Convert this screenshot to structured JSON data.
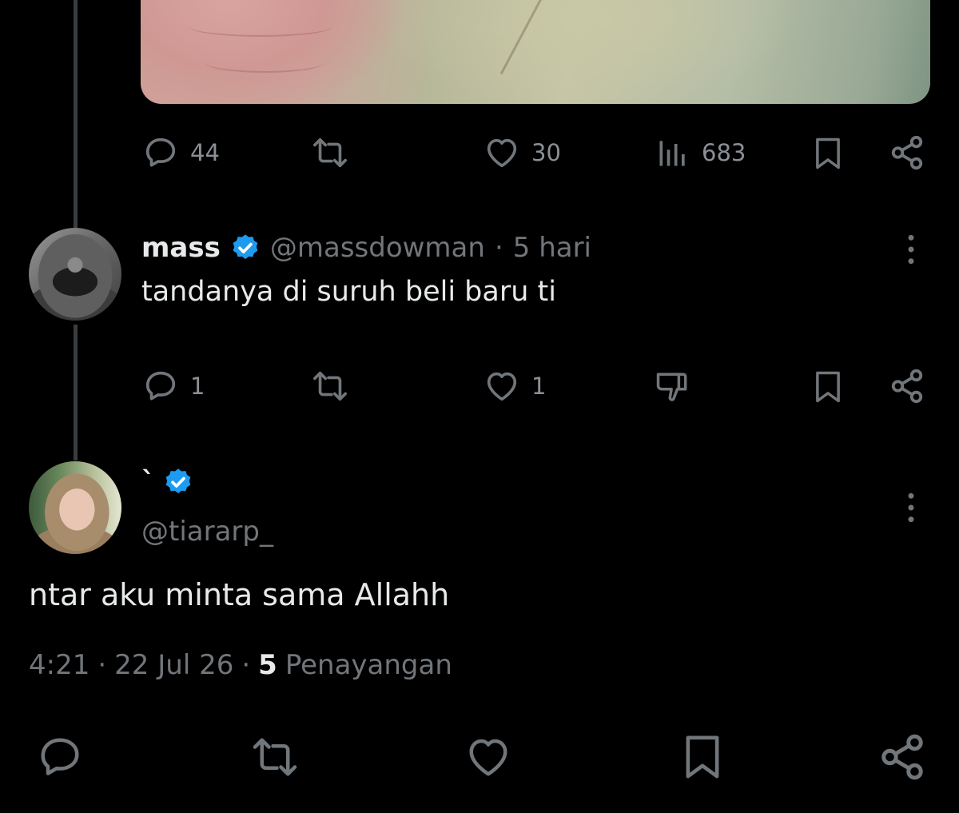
{
  "post": {
    "actions": {
      "replies": "44",
      "likes": "30",
      "views": "683"
    }
  },
  "reply_mass": {
    "display_name": "mass",
    "handle": "@massdowman",
    "separator": "·",
    "time": "5 hari",
    "text": "tandanya di suruh beli baru ti",
    "actions": {
      "replies": "1",
      "likes": "1"
    }
  },
  "reply_tiara": {
    "display_name": "`",
    "handle": "@tiararp_",
    "text": "ntar aku minta sama Allahh",
    "time": "4:21",
    "sep1": "·",
    "date": "22 Jul 26",
    "sep2": "·",
    "views_count": "5",
    "views_label": "Penayangan"
  },
  "colors": {
    "background": "#000000",
    "text_primary": "#e7e9ea",
    "text_secondary": "#71767b",
    "verified_blue": "#1d9bf0",
    "thread_line": "#3a3d40"
  },
  "icons": {
    "reply": "reply-icon",
    "repost": "repost-icon",
    "like": "heart-icon",
    "views": "views-icon",
    "bookmark": "bookmark-icon",
    "share": "share-icon",
    "dislike": "dislike-icon",
    "more": "more-vertical-icon",
    "verified": "verified-badge-icon"
  }
}
